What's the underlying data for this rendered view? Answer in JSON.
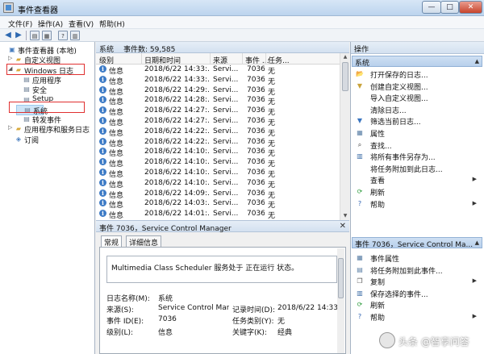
{
  "window": {
    "title": "事件查看器",
    "min": "—",
    "max": "□",
    "close": "✕"
  },
  "menu": [
    "文件(F)",
    "操作(A)",
    "查看(V)",
    "帮助(H)"
  ],
  "tree": [
    {
      "label": "事件查看器 (本地)",
      "level": 0,
      "icon": "computer-icon",
      "exp": ""
    },
    {
      "label": "自定义视图",
      "level": 1,
      "icon": "folder-icon",
      "exp": "▷"
    },
    {
      "label": "Windows 日志",
      "level": 1,
      "icon": "folder-icon",
      "exp": "◢"
    },
    {
      "label": "应用程序",
      "level": 2,
      "icon": "log-icon",
      "exp": ""
    },
    {
      "label": "安全",
      "level": 2,
      "icon": "log-icon",
      "exp": ""
    },
    {
      "label": "Setup",
      "level": 2,
      "icon": "log-icon",
      "exp": ""
    },
    {
      "label": "系统",
      "level": 2,
      "icon": "log-icon",
      "exp": "",
      "selected": true
    },
    {
      "label": "转发事件",
      "level": 2,
      "icon": "log-icon",
      "exp": ""
    },
    {
      "label": "应用程序和服务日志",
      "level": 1,
      "icon": "folder-icon",
      "exp": "▷"
    },
    {
      "label": "订阅",
      "level": 1,
      "icon": "subscription-icon",
      "exp": ""
    }
  ],
  "log": {
    "name": "系统",
    "count": "事件数: 59,585"
  },
  "columns": [
    "级别",
    "日期和时间",
    "来源",
    "事件 ...",
    "任务..."
  ],
  "rows": [
    {
      "level": "信息",
      "date": "2018/6/22 14:33:...",
      "source": "Servi...",
      "id": "7036",
      "task": "无"
    },
    {
      "level": "信息",
      "date": "2018/6/22 14:33:...",
      "source": "Servi...",
      "id": "7036",
      "task": "无"
    },
    {
      "level": "信息",
      "date": "2018/6/22 14:29:...",
      "source": "Servi...",
      "id": "7036",
      "task": "无"
    },
    {
      "level": "信息",
      "date": "2018/6/22 14:28:...",
      "source": "Servi...",
      "id": "7036",
      "task": "无"
    },
    {
      "level": "信息",
      "date": "2018/6/22 14:27:...",
      "source": "Servi...",
      "id": "7036",
      "task": "无"
    },
    {
      "level": "信息",
      "date": "2018/6/22 14:27:...",
      "source": "Servi...",
      "id": "7036",
      "task": "无"
    },
    {
      "level": "信息",
      "date": "2018/6/22 14:22:...",
      "source": "Servi...",
      "id": "7036",
      "task": "无"
    },
    {
      "level": "信息",
      "date": "2018/6/22 14:22:...",
      "source": "Servi...",
      "id": "7036",
      "task": "无"
    },
    {
      "level": "信息",
      "date": "2018/6/22 14:10:...",
      "source": "Servi...",
      "id": "7036",
      "task": "无"
    },
    {
      "level": "信息",
      "date": "2018/6/22 14:10:...",
      "source": "Servi...",
      "id": "7036",
      "task": "无"
    },
    {
      "level": "信息",
      "date": "2018/6/22 14:10:...",
      "source": "Servi...",
      "id": "7036",
      "task": "无"
    },
    {
      "level": "信息",
      "date": "2018/6/22 14:10:...",
      "source": "Servi...",
      "id": "7036",
      "task": "无"
    },
    {
      "level": "信息",
      "date": "2018/6/22 14:09:...",
      "source": "Servi...",
      "id": "7036",
      "task": "无"
    },
    {
      "level": "信息",
      "date": "2018/6/22 14:03:...",
      "source": "Servi...",
      "id": "7036",
      "task": "无"
    },
    {
      "level": "信息",
      "date": "2018/6/22 14:01:...",
      "source": "Servi...",
      "id": "7036",
      "task": "无"
    }
  ],
  "detail": {
    "title": "事件 7036，Service Control Manager",
    "tabs": [
      "常规",
      "详细信息"
    ],
    "description": "Multimedia Class Scheduler 服务处于 正在运行 状态。",
    "fields": [
      {
        "label": "日志名称(M):",
        "value": "系统"
      },
      {
        "label": "来源(S):",
        "value": "Service Control Man"
      },
      {
        "label": "事件 ID(E):",
        "value": "7036"
      },
      {
        "label": "级别(L):",
        "value": "信息"
      }
    ],
    "fields_right": [
      {
        "label": "记录时间(D):",
        "value": "2018/6/22 14:33:3"
      },
      {
        "label": "任务类别(Y):",
        "value": "无"
      },
      {
        "label": "关键字(K):",
        "value": "经典"
      }
    ]
  },
  "actions": {
    "header": "操作",
    "section1": "系统",
    "items1": [
      {
        "label": "打开保存的日志...",
        "icon": "open-folder-icon"
      },
      {
        "label": "创建自定义视图...",
        "icon": "filter-icon"
      },
      {
        "label": "导入自定义视图...",
        "icon": "blank"
      },
      {
        "label": "清除日志...",
        "icon": "blank"
      },
      {
        "label": "筛选当前日志...",
        "icon": "funnel-icon"
      },
      {
        "label": "属性",
        "icon": "properties-icon"
      },
      {
        "label": "查找...",
        "icon": "find-icon"
      },
      {
        "label": "将所有事件另存为...",
        "icon": "save-icon"
      },
      {
        "label": "将任务附加到此日志...",
        "icon": "blank"
      },
      {
        "label": "查看",
        "icon": "blank",
        "arrow": true
      },
      {
        "label": "刷新",
        "icon": "refresh-icon"
      },
      {
        "label": "帮助",
        "icon": "help-icon",
        "arrow": true
      }
    ],
    "section2": "事件 7036，Service Control Ma...",
    "items2": [
      {
        "label": "事件属性",
        "icon": "properties-icon"
      },
      {
        "label": "将任务附加到此事件...",
        "icon": "task-icon"
      },
      {
        "label": "复制",
        "icon": "copy-icon",
        "arrow": true
      },
      {
        "label": "保存选择的事件...",
        "icon": "save-icon"
      },
      {
        "label": "刷新",
        "icon": "refresh-icon"
      },
      {
        "label": "帮助",
        "icon": "help-icon",
        "arrow": true
      }
    ]
  },
  "watermark": "头条 @智享问答"
}
